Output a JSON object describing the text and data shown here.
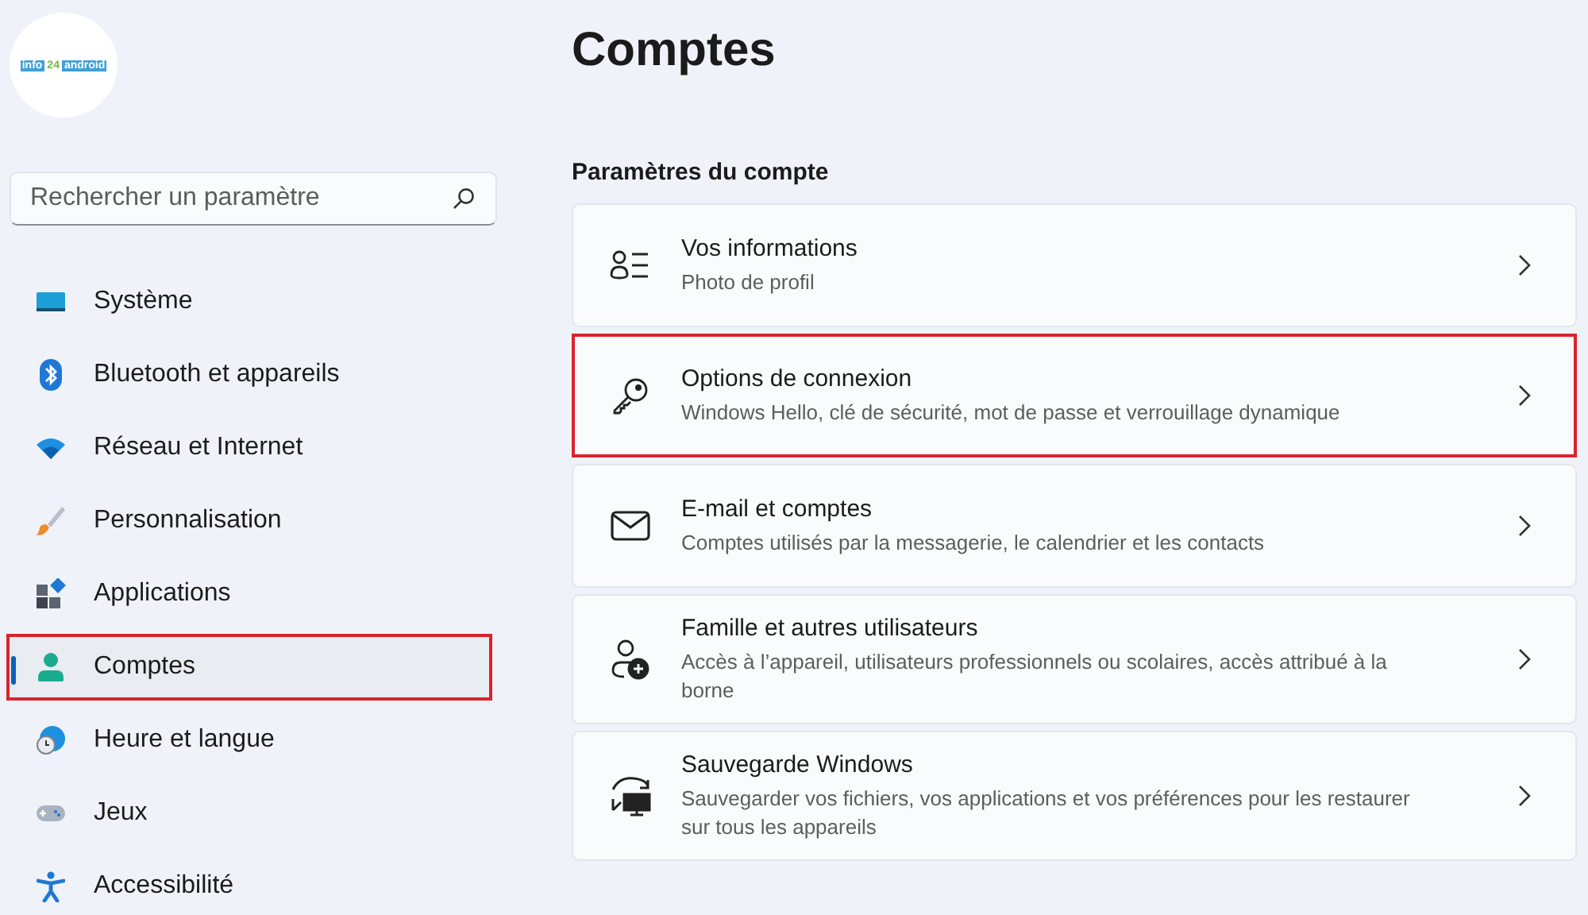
{
  "logo": {
    "parts": [
      "info",
      "24",
      "android"
    ]
  },
  "search": {
    "placeholder": "Rechercher un paramètre"
  },
  "sidebar": {
    "items": [
      {
        "label": "Système",
        "selected": false,
        "highlighted": false
      },
      {
        "label": "Bluetooth et appareils",
        "selected": false,
        "highlighted": false
      },
      {
        "label": "Réseau et Internet",
        "selected": false,
        "highlighted": false
      },
      {
        "label": "Personnalisation",
        "selected": false,
        "highlighted": false
      },
      {
        "label": "Applications",
        "selected": false,
        "highlighted": false
      },
      {
        "label": "Comptes",
        "selected": true,
        "highlighted": true
      },
      {
        "label": "Heure et langue",
        "selected": false,
        "highlighted": false
      },
      {
        "label": "Jeux",
        "selected": false,
        "highlighted": false
      },
      {
        "label": "Accessibilité",
        "selected": false,
        "highlighted": false
      }
    ]
  },
  "page": {
    "title": "Comptes",
    "section": "Paramètres du compte",
    "cards": [
      {
        "title": "Vos informations",
        "subtitle": "Photo de profil",
        "highlighted": false
      },
      {
        "title": "Options de connexion",
        "subtitle": "Windows Hello, clé de sécurité, mot de passe et verrouillage dynamique",
        "highlighted": true
      },
      {
        "title": "E-mail et comptes",
        "subtitle": "Comptes utilisés par la messagerie, le calendrier et les contacts",
        "highlighted": false
      },
      {
        "title": "Famille et autres utilisateurs",
        "subtitle": "Accès à l’appareil, utilisateurs professionnels ou scolaires, accès attribué à la borne",
        "highlighted": false
      },
      {
        "title": "Sauvegarde Windows",
        "subtitle": "Sauvegarder vos fichiers, vos applications et vos préférences pour les restaurer sur tous les appareils",
        "highlighted": false
      }
    ]
  }
}
